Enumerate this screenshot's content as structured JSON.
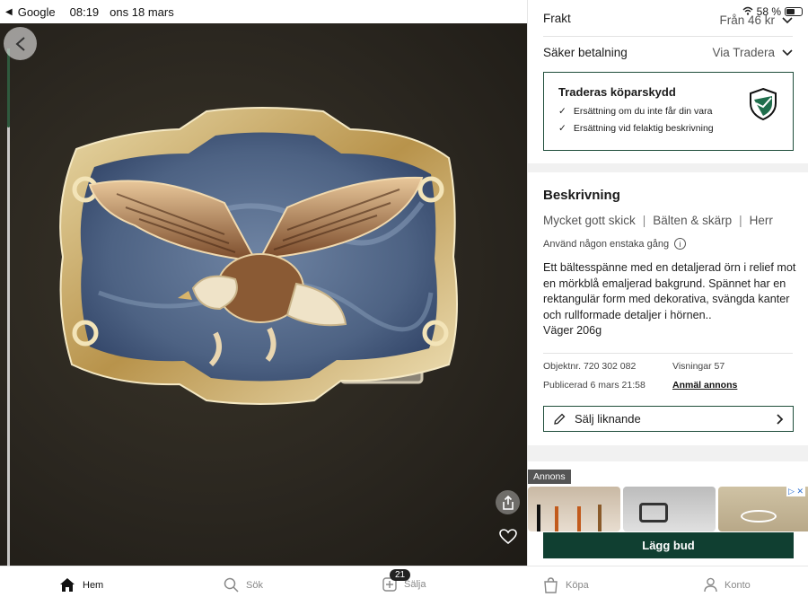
{
  "status_bar": {
    "back_app": "Google",
    "time": "08:19",
    "date": "ons 18 mars",
    "battery": "58 %",
    "battery_level": 0.58
  },
  "photo": {
    "alt": "Bältesspänne med örn"
  },
  "shipping": {
    "label": "Frakt",
    "value": "Från 46 kr"
  },
  "payment": {
    "label": "Säker betalning",
    "value": "Via Tradera"
  },
  "protection": {
    "title": "Traderas köparskydd",
    "items": [
      "Ersättning om du inte får din vara",
      "Ersättning vid felaktig beskrivning"
    ]
  },
  "description": {
    "title": "Beskrivning",
    "condition": "Mycket gott skick",
    "category": "Bälten & skärp",
    "gender": "Herr",
    "separator": "|",
    "usage": "Använd någon enstaka gång",
    "info_glyph": "i",
    "body": "Ett bältesspänne med en detaljerad örn i relief mot en mörkblå emaljerad bakgrund. Spännet har en rektangulär form med dekorativa, svängda kanter och rullformade detaljer i hörnen..",
    "weight": "Väger 206g"
  },
  "meta": {
    "object_nr": "Objektnr. 720 302 082",
    "views": "Visningar 57",
    "published": "Publicerad 6 mars 21:58",
    "report": "Anmäl annons"
  },
  "sell_similar": "Sälj liknande",
  "ad": {
    "label": "Annons",
    "badge": "▷ ✕"
  },
  "bid_button": "Lägg bud",
  "nav": {
    "home": "Hem",
    "search": "Sök",
    "sell": "Sälja",
    "sell_badge": "21",
    "buy": "Köpa",
    "account": "Konto"
  },
  "colors": {
    "brand_green": "#103f31",
    "accent_green": "#1f4d3a"
  }
}
